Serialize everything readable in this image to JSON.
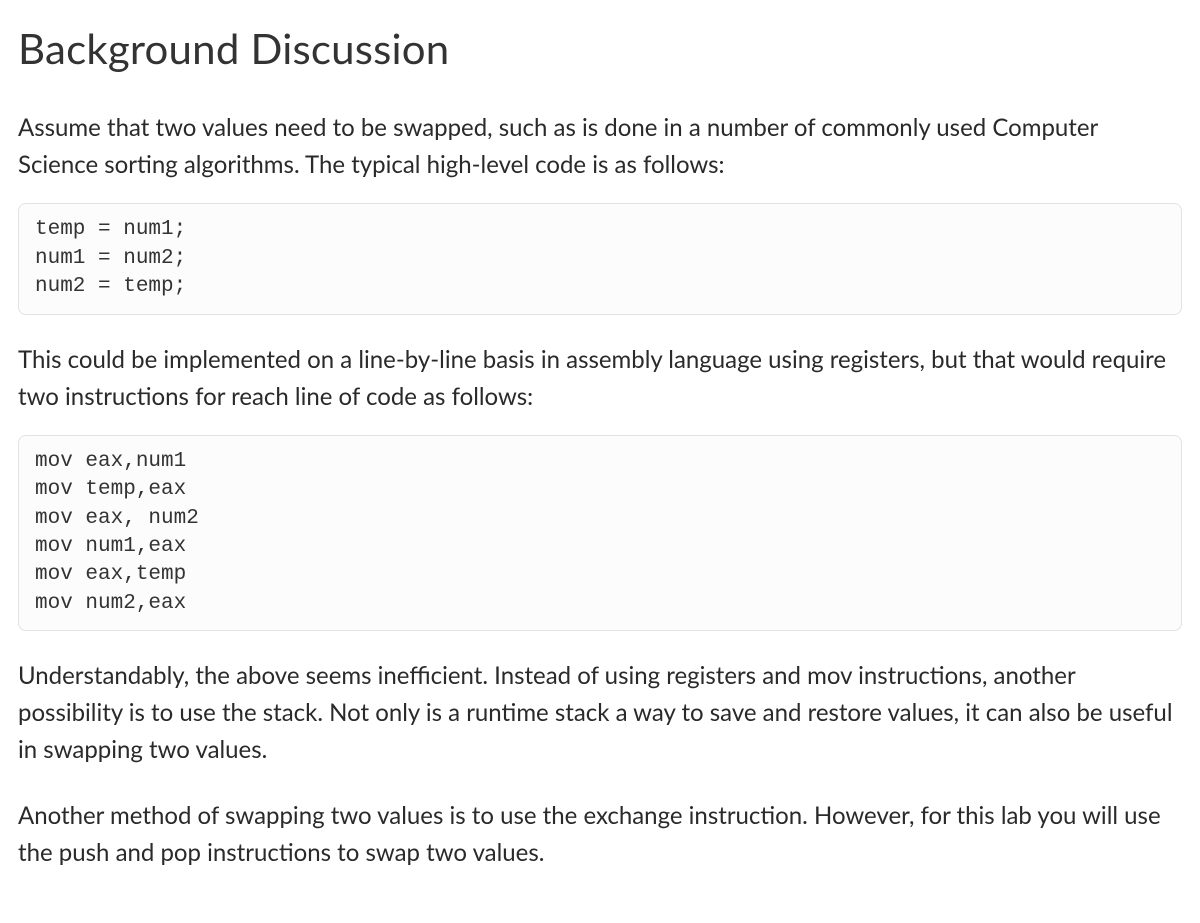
{
  "heading": "Background Discussion",
  "para1": "Assume that two values need to be swapped, such as is done in a number of commonly  used Computer Science sorting algorithms.   The typical high-level code is as follows:",
  "code1": "temp = num1;\nnum1 = num2;\nnum2 = temp;",
  "para2": "This could be implemented on a line-by-line basis in assembly language using registers, but that would require two instructions for reach line of code as follows:",
  "code2": "mov eax,num1\nmov temp,eax\nmov eax, num2\nmov num1,eax\nmov eax,temp\nmov num2,eax",
  "para3": "Understandably, the above seems inefficient.  Instead of using registers and mov instructions, another possibility is to use the stack.  Not only is a runtime stack a way to save and restore values, it can also be useful in swapping two values.",
  "para4": "Another method of swapping two values is to use the exchange instruction.  However, for this lab you will use the push and pop instructions to swap two values."
}
